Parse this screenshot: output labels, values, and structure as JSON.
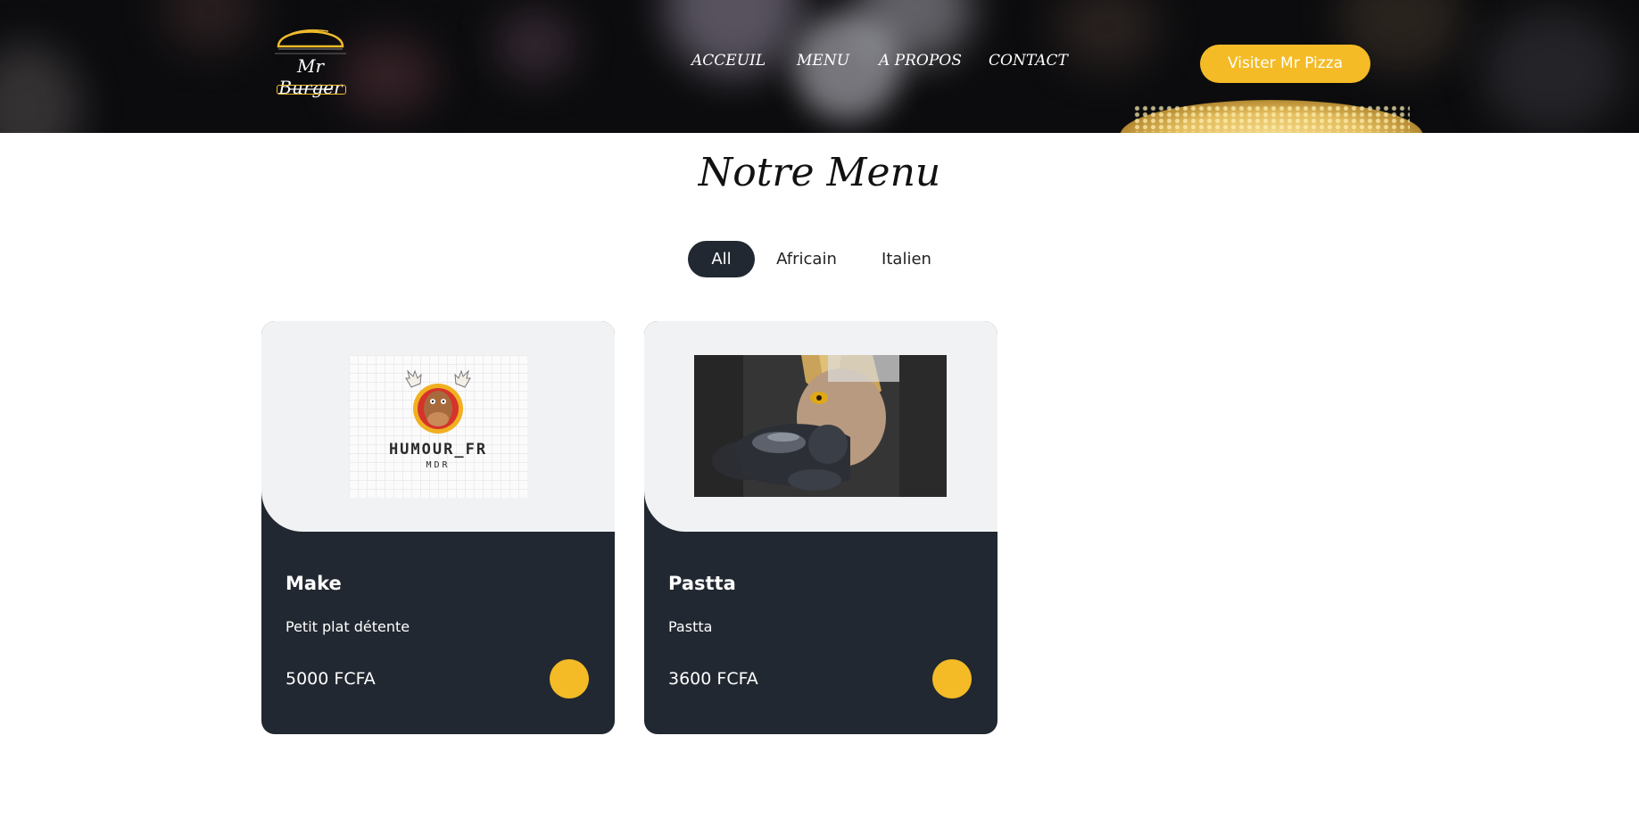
{
  "brand": {
    "logo_text": "Mr Burger",
    "accent_color": "#f4bb26",
    "dark_color": "#222831"
  },
  "nav": {
    "items": [
      "ACCEUIL",
      "MENU",
      "A PROPOS",
      "CONTACT"
    ],
    "cta_label": "Visiter Mr Pizza"
  },
  "menu": {
    "title": "Notre Menu",
    "filters": [
      {
        "label": "All",
        "active": true
      },
      {
        "label": "Africain",
        "active": false
      },
      {
        "label": "Italien",
        "active": false
      }
    ],
    "items": [
      {
        "name": "Make",
        "description": "Petit plat détente",
        "price": "5000 FCFA",
        "image_text": "HUMOUR_FR",
        "image_subtext": "MDR",
        "cart_icon": "cart-icon"
      },
      {
        "name": "Pastta",
        "description": "Pastta",
        "price": "3600 FCFA",
        "cart_icon": "cart-icon"
      }
    ]
  }
}
